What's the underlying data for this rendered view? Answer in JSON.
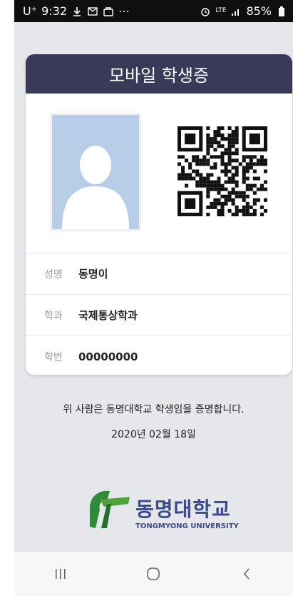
{
  "status": {
    "carrier": "U⁺",
    "time": "9:32",
    "network": "LTE",
    "battery": "85%"
  },
  "card": {
    "title": "모바일 학생증",
    "rows": [
      {
        "label": "성명",
        "value": "동명이"
      },
      {
        "label": "학과",
        "value": "국제통상학과"
      },
      {
        "label": "학번",
        "value": "00000000"
      }
    ]
  },
  "certification": "위 사람은 동명대학교 학생임을 증명합니다.",
  "date": "2020년 02월 18일",
  "logo": {
    "name": "동명대학교",
    "english": "TONGMYONG UNIVERSITY"
  },
  "colors": {
    "header": "#383a58",
    "logo_green": "#2f8a3a",
    "logo_blue": "#3a4a8a"
  }
}
